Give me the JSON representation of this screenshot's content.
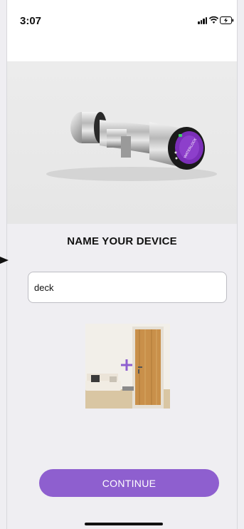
{
  "status_bar": {
    "time": "3:07",
    "signal_icon": "cellular-signal-icon",
    "wifi_icon": "wifi-icon",
    "battery_icon": "battery-charging-icon"
  },
  "hero": {
    "image": "smart-lock-cylinder-image",
    "brand_text": "WATERLOCK"
  },
  "main": {
    "title": "NAME YOUR DEVICE",
    "device_name_value": "deck",
    "device_name_placeholder": "",
    "room_image": "room-door-illustration",
    "add_icon": "plus-icon"
  },
  "footer": {
    "continue_label": "CONTINUE"
  },
  "colors": {
    "accent": "#8e5fcf",
    "background": "#efeef2"
  }
}
